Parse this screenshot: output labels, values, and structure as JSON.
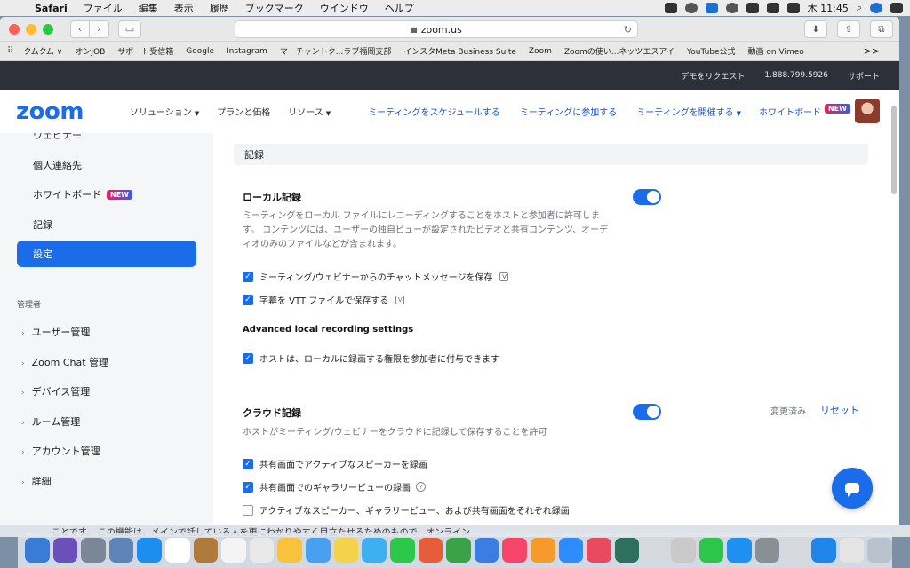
{
  "menubar": {
    "app": "Safari",
    "items": [
      "ファイル",
      "編集",
      "表示",
      "履歴",
      "ブックマーク",
      "ウインドウ",
      "ヘルプ"
    ],
    "clock": "木 11:45"
  },
  "browser": {
    "url": "zoom.us",
    "bookmarks": [
      "クムクム ∨",
      "オンJOB",
      "サポート受信箱",
      "Google",
      "Instagram",
      "マーチャントク...ラブ福岡支部",
      "インスタMeta Business Suite",
      "Zoom",
      "Zoomの使い...ネッツエスアイ",
      "YouTube公式",
      "動画 on Vimeo"
    ],
    "more": ">>"
  },
  "topstrip": {
    "request_demo": "デモをリクエスト",
    "phone": "1.888.799.5926",
    "support": "サポート"
  },
  "nav": {
    "logo": "zoom",
    "solutions": "ソリューション",
    "plans": "プランと価格",
    "resources": "リソース",
    "schedule": "ミーティングをスケジュールする",
    "join": "ミーティングに参加する",
    "host": "ミーティングを開催する",
    "whiteboard": "ホワイトボード",
    "new_badge": "NEW"
  },
  "sidebar": {
    "cut_item": "ウェビナー",
    "items": [
      "個人連絡先",
      "ホワイトボード",
      "記録"
    ],
    "active": "設定",
    "new_badge": "NEW",
    "admin_label": "管理者",
    "admin_items": [
      "ユーザー管理",
      "Zoom Chat 管理",
      "デバイス管理",
      "ルーム管理",
      "アカウント管理",
      "詳細"
    ]
  },
  "main": {
    "section_title": "記録",
    "local": {
      "title": "ローカル記録",
      "description": "ミーティングをローカル ファイルにレコーディングすることをホストと参加者に許可します。 コンテンツには、ユーザーの独自ビューが設定されたビデオと共有コンテンツ、オーディオのみのファイルなどが含まれます。",
      "option1": "ミーティング/ウェビナーからのチャットメッセージを保存",
      "option2": "字幕を VTT ファイルで保存する",
      "advanced_title": "Advanced local recording settings",
      "option3": "ホストは、ローカルに録画する権限を参加者に付与できます"
    },
    "cloud": {
      "title": "クラウド記録",
      "modified": "変更済み",
      "reset": "リセット",
      "description": "ホストがミーティング/ウェビナーをクラウドに記録して保存することを許可",
      "option1": "共有画面でアクティブなスピーカーを録画",
      "option2": "共有画面でのギャラリービューの録画",
      "option3": "アクティブなスピーカー、ギャラリービュー、および共有画面をそれぞれ録画"
    }
  },
  "background_text": "ことです。 この機能は、メインで話している人を更にわかりやすく目立たせるためのもので、オンライン",
  "colors": {
    "accent": "#1a6ce8",
    "topstrip": "#2d3038"
  }
}
